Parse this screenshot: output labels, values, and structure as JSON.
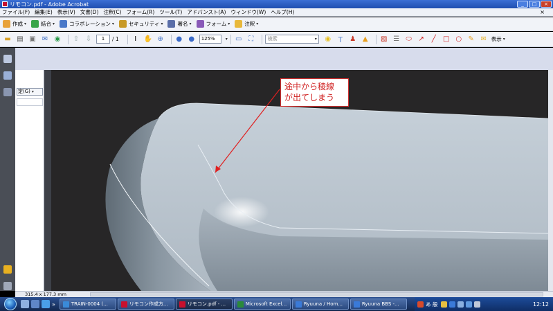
{
  "window": {
    "title": "リモコン.pdf - Adobe Acrobat"
  },
  "menu": {
    "items": [
      "ファイル(F)",
      "編集(E)",
      "表示(V)",
      "文書(D)",
      "注釈(C)",
      "フォーム(R)",
      "ツール(T)",
      "アドバンスト(A)",
      "ウィンドウ(W)",
      "ヘルプ(H)"
    ]
  },
  "toolbar": {
    "items": [
      {
        "label": "作成",
        "icon": "create-icon",
        "color": "#e8a23a"
      },
      {
        "label": "結合",
        "icon": "combine-icon",
        "color": "#3aa54a"
      },
      {
        "label": "コラボレーション",
        "icon": "collaboration-icon",
        "color": "#4a78c8"
      },
      {
        "label": "セキュリティ",
        "icon": "lock-icon",
        "color": "#c89a28"
      },
      {
        "label": "署名",
        "icon": "pen-icon",
        "color": "#5a6ea8"
      },
      {
        "label": "フォーム",
        "icon": "form-icon",
        "color": "#8a5ab8"
      },
      {
        "label": "注釈",
        "icon": "comment-icon",
        "color": "#e8b83a"
      }
    ]
  },
  "navbar": {
    "page_current": "1",
    "page_total": "/ 1",
    "zoom": "125%",
    "search_placeholder": "検索",
    "display_label": "表示"
  },
  "sidepanel": {
    "fit_label": "定(G)"
  },
  "annotation": {
    "line1": "途中から稜線",
    "line2": "が出てしまう"
  },
  "status": {
    "dimensions": "315.4 x 177.3 mm"
  },
  "taskbar": {
    "tasks": [
      {
        "label": "TRAIN-0004 (...",
        "color": "#3a8ad8"
      },
      {
        "label": "リモコン作成方...",
        "color": "#c8102e"
      },
      {
        "label": "リモコン.pdf - ...",
        "color": "#c8102e"
      },
      {
        "label": "Microsoft Excel...",
        "color": "#2a8a3a"
      },
      {
        "label": "Ryuuna / Hom...",
        "color": "#3a7ad8"
      },
      {
        "label": "Ryuuna BBS -...",
        "color": "#3a7ad8"
      }
    ],
    "ime": "あ 般",
    "clock": "12:12"
  }
}
